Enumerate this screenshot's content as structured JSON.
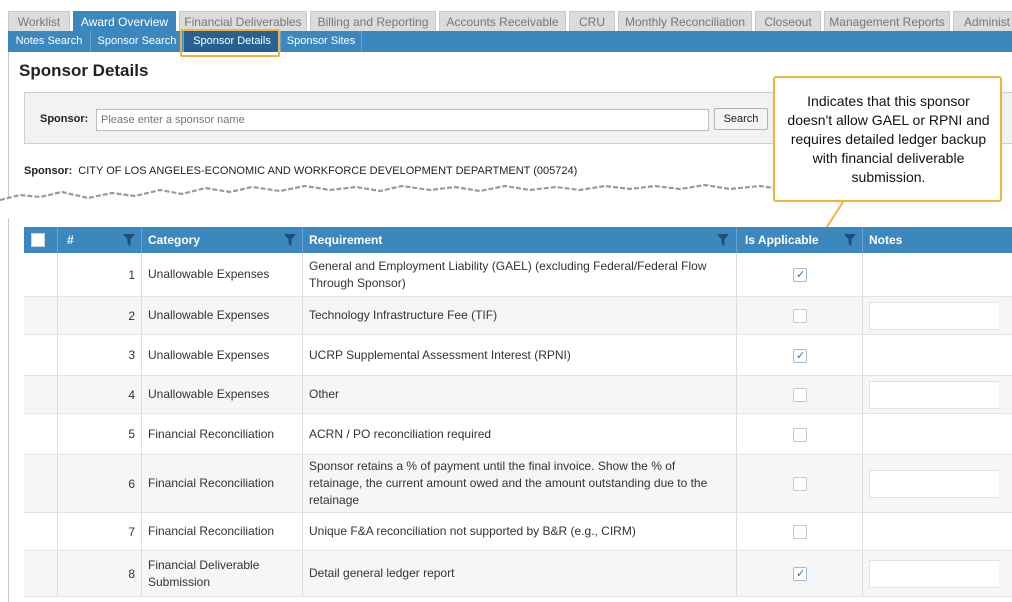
{
  "tabs": [
    {
      "label": "Worklist",
      "active": false
    },
    {
      "label": "Award Overview",
      "active": true
    },
    {
      "label": "Financial Deliverables",
      "active": false
    },
    {
      "label": "Billing and Reporting",
      "active": false
    },
    {
      "label": "Accounts Receivable",
      "active": false
    },
    {
      "label": "CRU",
      "active": false
    },
    {
      "label": "Monthly Reconciliation",
      "active": false
    },
    {
      "label": "Closeout",
      "active": false
    },
    {
      "label": "Management Reports",
      "active": false
    },
    {
      "label": "Administ",
      "active": false
    }
  ],
  "subtabs": [
    {
      "label": "Notes Search",
      "active": false
    },
    {
      "label": "Sponsor Search",
      "active": false
    },
    {
      "label": "Sponsor Details",
      "active": true
    },
    {
      "label": "Sponsor Sites",
      "active": false
    }
  ],
  "page_title": "Sponsor Details",
  "search": {
    "label": "Sponsor:",
    "placeholder": "Please enter a sponsor name",
    "value": "",
    "button": "Search"
  },
  "sponsor": {
    "label": "Sponsor:",
    "name": "CITY OF LOS ANGELES-ECONOMIC AND WORKFORCE DEVELOPMENT DEPARTMENT (005724)"
  },
  "callout": {
    "text": "Indicates that this sponsor doesn't allow GAEL or RPNI and requires detailed ledger backup with financial deliverable submission.",
    "border_color": "#f0b43a"
  },
  "table": {
    "columns": {
      "num": "#",
      "category": "Category",
      "requirement": "Requirement",
      "applicable": "Is Applicable",
      "notes": "Notes"
    },
    "rows": [
      {
        "num": "1",
        "category": "Unallowable Expenses",
        "requirement": "General and Employment Liability (GAEL)  (excluding Federal/Federal Flow Through Sponsor)",
        "applicable": true,
        "has_note_box": false
      },
      {
        "num": "2",
        "category": "Unallowable Expenses",
        "requirement": "Technology Infrastructure Fee (TIF)",
        "applicable": false,
        "has_note_box": true
      },
      {
        "num": "3",
        "category": "Unallowable Expenses",
        "requirement": "UCRP Supplemental Assessment Interest (RPNI)",
        "applicable": true,
        "has_note_box": false
      },
      {
        "num": "4",
        "category": "Unallowable Expenses",
        "requirement": "Other",
        "applicable": false,
        "has_note_box": true
      },
      {
        "num": "5",
        "category": "Financial Reconciliation",
        "requirement": "ACRN / PO reconciliation required",
        "applicable": false,
        "has_note_box": false
      },
      {
        "num": "6",
        "category": "Financial Reconciliation",
        "requirement": "Sponsor retains a % of payment until the final invoice.  Show the % of retainage, the current amount owed and the amount outstanding due to the retainage",
        "applicable": false,
        "has_note_box": true
      },
      {
        "num": "7",
        "category": "Financial Reconciliation",
        "requirement": "Unique F&A reconciliation not supported by B&R (e.g., CIRM)",
        "applicable": false,
        "has_note_box": false
      },
      {
        "num": "8",
        "category": "Financial Deliverable Submission",
        "requirement": "Detail general ledger report",
        "applicable": true,
        "has_note_box": true
      }
    ]
  },
  "colors": {
    "accent": "#3b87be",
    "accent_dark": "#27618f",
    "highlight": "#f0b43a"
  }
}
